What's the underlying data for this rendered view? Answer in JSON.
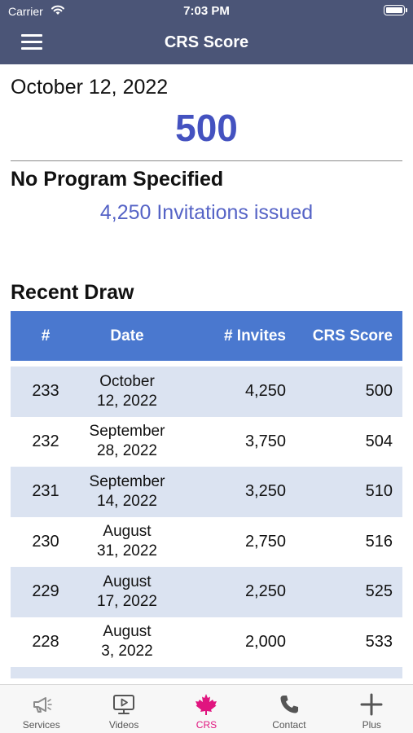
{
  "status_bar": {
    "carrier": "Carrier",
    "time": "7:03 PM"
  },
  "nav": {
    "title": "CRS Score"
  },
  "latest_draw": {
    "date": "October 12, 2022",
    "score": "500",
    "program": "No Program Specified",
    "invitations": "4,250 Invitations issued"
  },
  "recent": {
    "heading": "Recent Draw",
    "columns": {
      "num": "#",
      "date": "Date",
      "invites": "# Invites",
      "crs": "CRS Score"
    },
    "rows": [
      {
        "num": "233",
        "date_line1": "October",
        "date_line2": "12, 2022",
        "invites": "4,250",
        "crs": "500"
      },
      {
        "num": "232",
        "date_line1": "September",
        "date_line2": "28, 2022",
        "invites": "3,750",
        "crs": "504"
      },
      {
        "num": "231",
        "date_line1": "September",
        "date_line2": "14, 2022",
        "invites": "3,250",
        "crs": "510"
      },
      {
        "num": "230",
        "date_line1": "August",
        "date_line2": "31, 2022",
        "invites": "2,750",
        "crs": "516"
      },
      {
        "num": "229",
        "date_line1": "August",
        "date_line2": "17, 2022",
        "invites": "2,250",
        "crs": "525"
      },
      {
        "num": "228",
        "date_line1": "August",
        "date_line2": "3, 2022",
        "invites": "2,000",
        "crs": "533"
      }
    ]
  },
  "tabs": [
    {
      "label": "Services",
      "icon": "megaphone-icon"
    },
    {
      "label": "Videos",
      "icon": "video-monitor-icon"
    },
    {
      "label": "CRS",
      "icon": "maple-leaf-icon",
      "active": true
    },
    {
      "label": "Contact",
      "icon": "phone-icon"
    },
    {
      "label": "Plus",
      "icon": "plus-icon"
    }
  ],
  "colors": {
    "header": "#4b5577",
    "accent_score": "#4452c0",
    "table_header": "#4a78cf",
    "row_alt": "#dbe3f1",
    "active_tab": "#e0157f"
  }
}
